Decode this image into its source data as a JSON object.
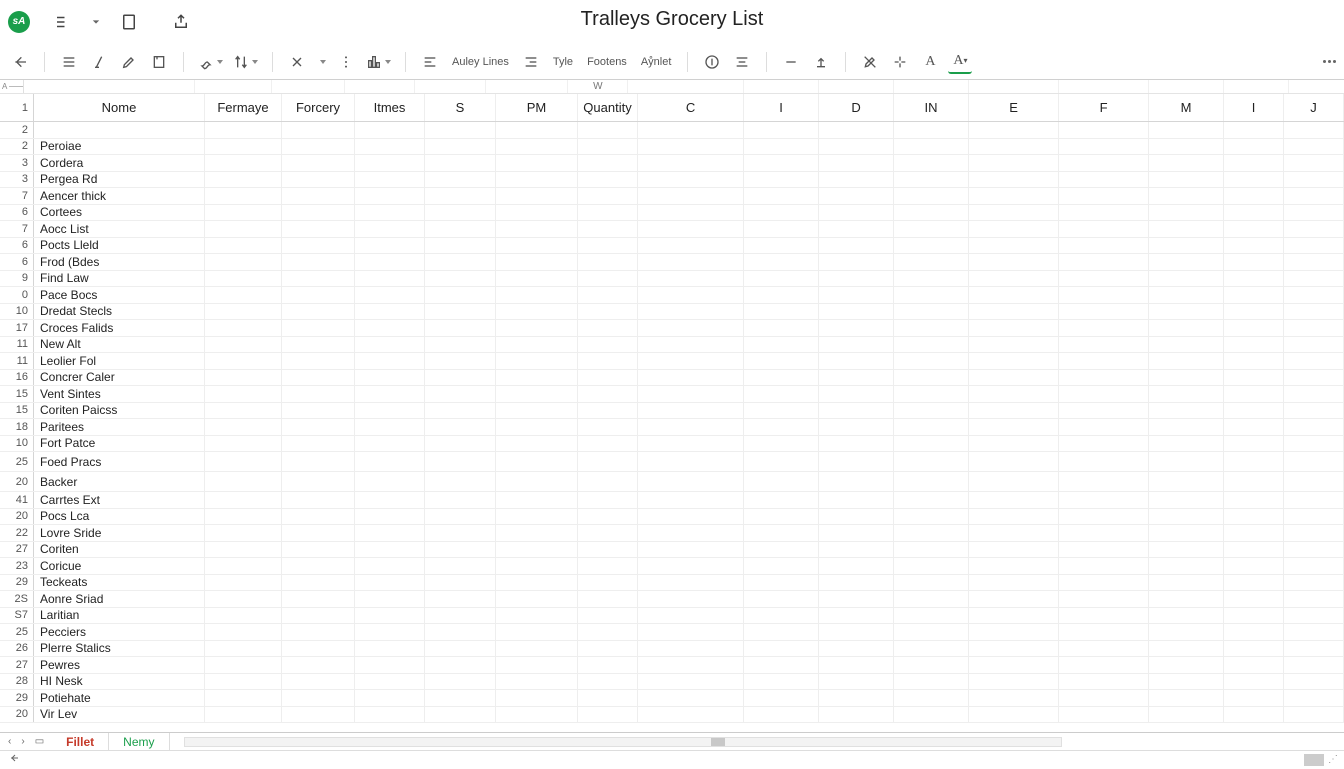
{
  "app": {
    "badge": "sA"
  },
  "document": {
    "title": "Tralleys Grocery List"
  },
  "titlebar_icons": [
    "list-icon",
    "caret-icon",
    "page-icon",
    "share-icon"
  ],
  "toolbar": {
    "groups": [
      [
        "back-arrow"
      ],
      [
        "align-justify",
        "italic-pen",
        "pen",
        "page-box"
      ],
      [
        "brush-caret",
        "sort-caret"
      ],
      [
        "x-clear",
        "dots-vert-small",
        "caret",
        "chart-caret"
      ],
      [
        "lines-left"
      ],
      [
        "lines-right"
      ]
    ],
    "labels": {
      "auley": "Auley Lines",
      "tyle": "Tyle",
      "footens": "Footens",
      "arnlet": "Aẙnlet"
    },
    "rightGroup": [
      "circle-i",
      "align-center"
    ],
    "farGroup": [
      "minus",
      "up-bar"
    ],
    "styleGroup": [
      "pen-slash",
      "sparkle",
      "font-a",
      "font-a-sub"
    ]
  },
  "name_ref": {
    "col": "A",
    "line": "____"
  },
  "column_letter_strip": {
    "w": "W"
  },
  "headers": [
    "Nome",
    "Fermaye",
    "Forcery",
    "Itmes",
    "S",
    "PM",
    "Quantity",
    "C",
    "I",
    "D",
    "IN",
    "E",
    "F",
    "M",
    "I",
    "J"
  ],
  "rows": [
    {
      "num": "1",
      "name": "",
      "isHeader": true
    },
    {
      "num": "2",
      "name": ""
    },
    {
      "num": "2",
      "name": "Peroiae"
    },
    {
      "num": "3",
      "name": "Cordera"
    },
    {
      "num": "3",
      "name": "Pergea Rd"
    },
    {
      "num": "7",
      "name": "Aencer thick"
    },
    {
      "num": "6",
      "name": "Cortees"
    },
    {
      "num": "7",
      "name": "Aocc List"
    },
    {
      "num": "6",
      "name": "Pocts Lleld"
    },
    {
      "num": "6",
      "name": "Frod (Bdes"
    },
    {
      "num": "9",
      "name": "Find Law"
    },
    {
      "num": "0",
      "name": "Pace Bocs"
    },
    {
      "num": "10",
      "name": "Dredat Stecls"
    },
    {
      "num": "17",
      "name": "Croces Falids"
    },
    {
      "num": "11",
      "name": "New Alt"
    },
    {
      "num": "11",
      "name": "Leolier Fol"
    },
    {
      "num": "16",
      "name": "Concrer Caler"
    },
    {
      "num": "15",
      "name": "Vent Sintes"
    },
    {
      "num": "15",
      "name": "Coriten Paicss"
    },
    {
      "num": "18",
      "name": "Paritees"
    },
    {
      "num": "10",
      "name": "Fort Patce"
    },
    {
      "num": "25",
      "name": "Foed Pracs",
      "tall": true
    },
    {
      "num": "20",
      "name": "Backer",
      "tall": true
    },
    {
      "num": "41",
      "name": "Carrtes Ext"
    },
    {
      "num": "20",
      "name": "Pocs Lca"
    },
    {
      "num": "22",
      "name": "Lovre Sride"
    },
    {
      "num": "27",
      "name": "Coriten"
    },
    {
      "num": "23",
      "name": "Coricue"
    },
    {
      "num": "29",
      "name": "Teckeats"
    },
    {
      "num": "2S",
      "name": "Aonre Sriad"
    },
    {
      "num": "S7",
      "name": "Laritian"
    },
    {
      "num": "25",
      "name": "Pecciers"
    },
    {
      "num": "26",
      "name": "Plerre Stalics"
    },
    {
      "num": "27",
      "name": "Pewres"
    },
    {
      "num": "28",
      "name": "HI Nesk"
    },
    {
      "num": "29",
      "name": "Potiehate"
    },
    {
      "num": "20",
      "name": "Vir Lev"
    }
  ],
  "tabs": {
    "nav": [
      "‹",
      "›",
      "▭"
    ],
    "items": [
      {
        "label": "Fillet",
        "color": "#c53a2a",
        "active": true
      },
      {
        "label": "Nemy",
        "color": "#1a9e4b",
        "active": false
      }
    ]
  },
  "status": {
    "back": "←"
  }
}
